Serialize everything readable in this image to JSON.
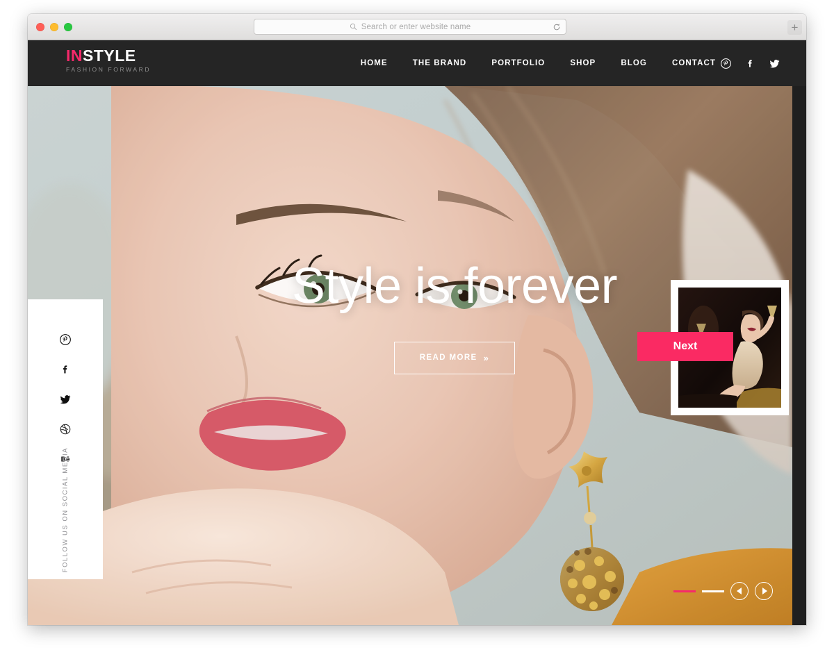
{
  "browser": {
    "traffic_lights": [
      {
        "name": "close",
        "color": "#ff5f57"
      },
      {
        "name": "minimize",
        "color": "#febc2e"
      },
      {
        "name": "maximize",
        "color": "#28c840"
      }
    ],
    "address_bar": {
      "value": "",
      "placeholder": "Search or enter website name",
      "search_icon": "search-icon",
      "reload_icon": "reload-icon"
    },
    "new_tab_label": "+"
  },
  "site": {
    "header": {
      "logo": {
        "part_highlight": "IN",
        "part_rest": "STYLE",
        "tagline": "FASHION FORWARD",
        "highlight_color": "#f6296a"
      },
      "nav": [
        {
          "label": "HOME",
          "name": "nav-home"
        },
        {
          "label": "THE BRAND",
          "name": "nav-the-brand"
        },
        {
          "label": "PORTFOLIO",
          "name": "nav-portfolio"
        },
        {
          "label": "SHOP",
          "name": "nav-shop"
        },
        {
          "label": "BLOG",
          "name": "nav-blog"
        },
        {
          "label": "CONTACT",
          "name": "nav-contact"
        }
      ],
      "social": [
        {
          "icon": "pinterest-icon"
        },
        {
          "icon": "facebook-icon"
        },
        {
          "icon": "twitter-icon"
        }
      ],
      "background_color": "#252525"
    },
    "social_rail": {
      "icons": [
        {
          "icon": "pinterest-icon"
        },
        {
          "icon": "facebook-icon"
        },
        {
          "icon": "twitter-icon"
        },
        {
          "icon": "dribbble-icon"
        },
        {
          "icon": "behance-icon"
        }
      ],
      "label": "FOLLOW US ON SOCIAL MEDIA"
    },
    "hero": {
      "title": "Style is forever",
      "cta_label": "READ MORE",
      "cta_chevron": "»"
    },
    "next_slide": {
      "badge_label": "Next",
      "badge_color": "#fa2a63"
    },
    "slider": {
      "dots": [
        {
          "state": "active"
        },
        {
          "state": "inactive"
        }
      ],
      "prev_label": "prev-slide",
      "next_label": "next-slide",
      "active_color": "#f6296a"
    }
  }
}
